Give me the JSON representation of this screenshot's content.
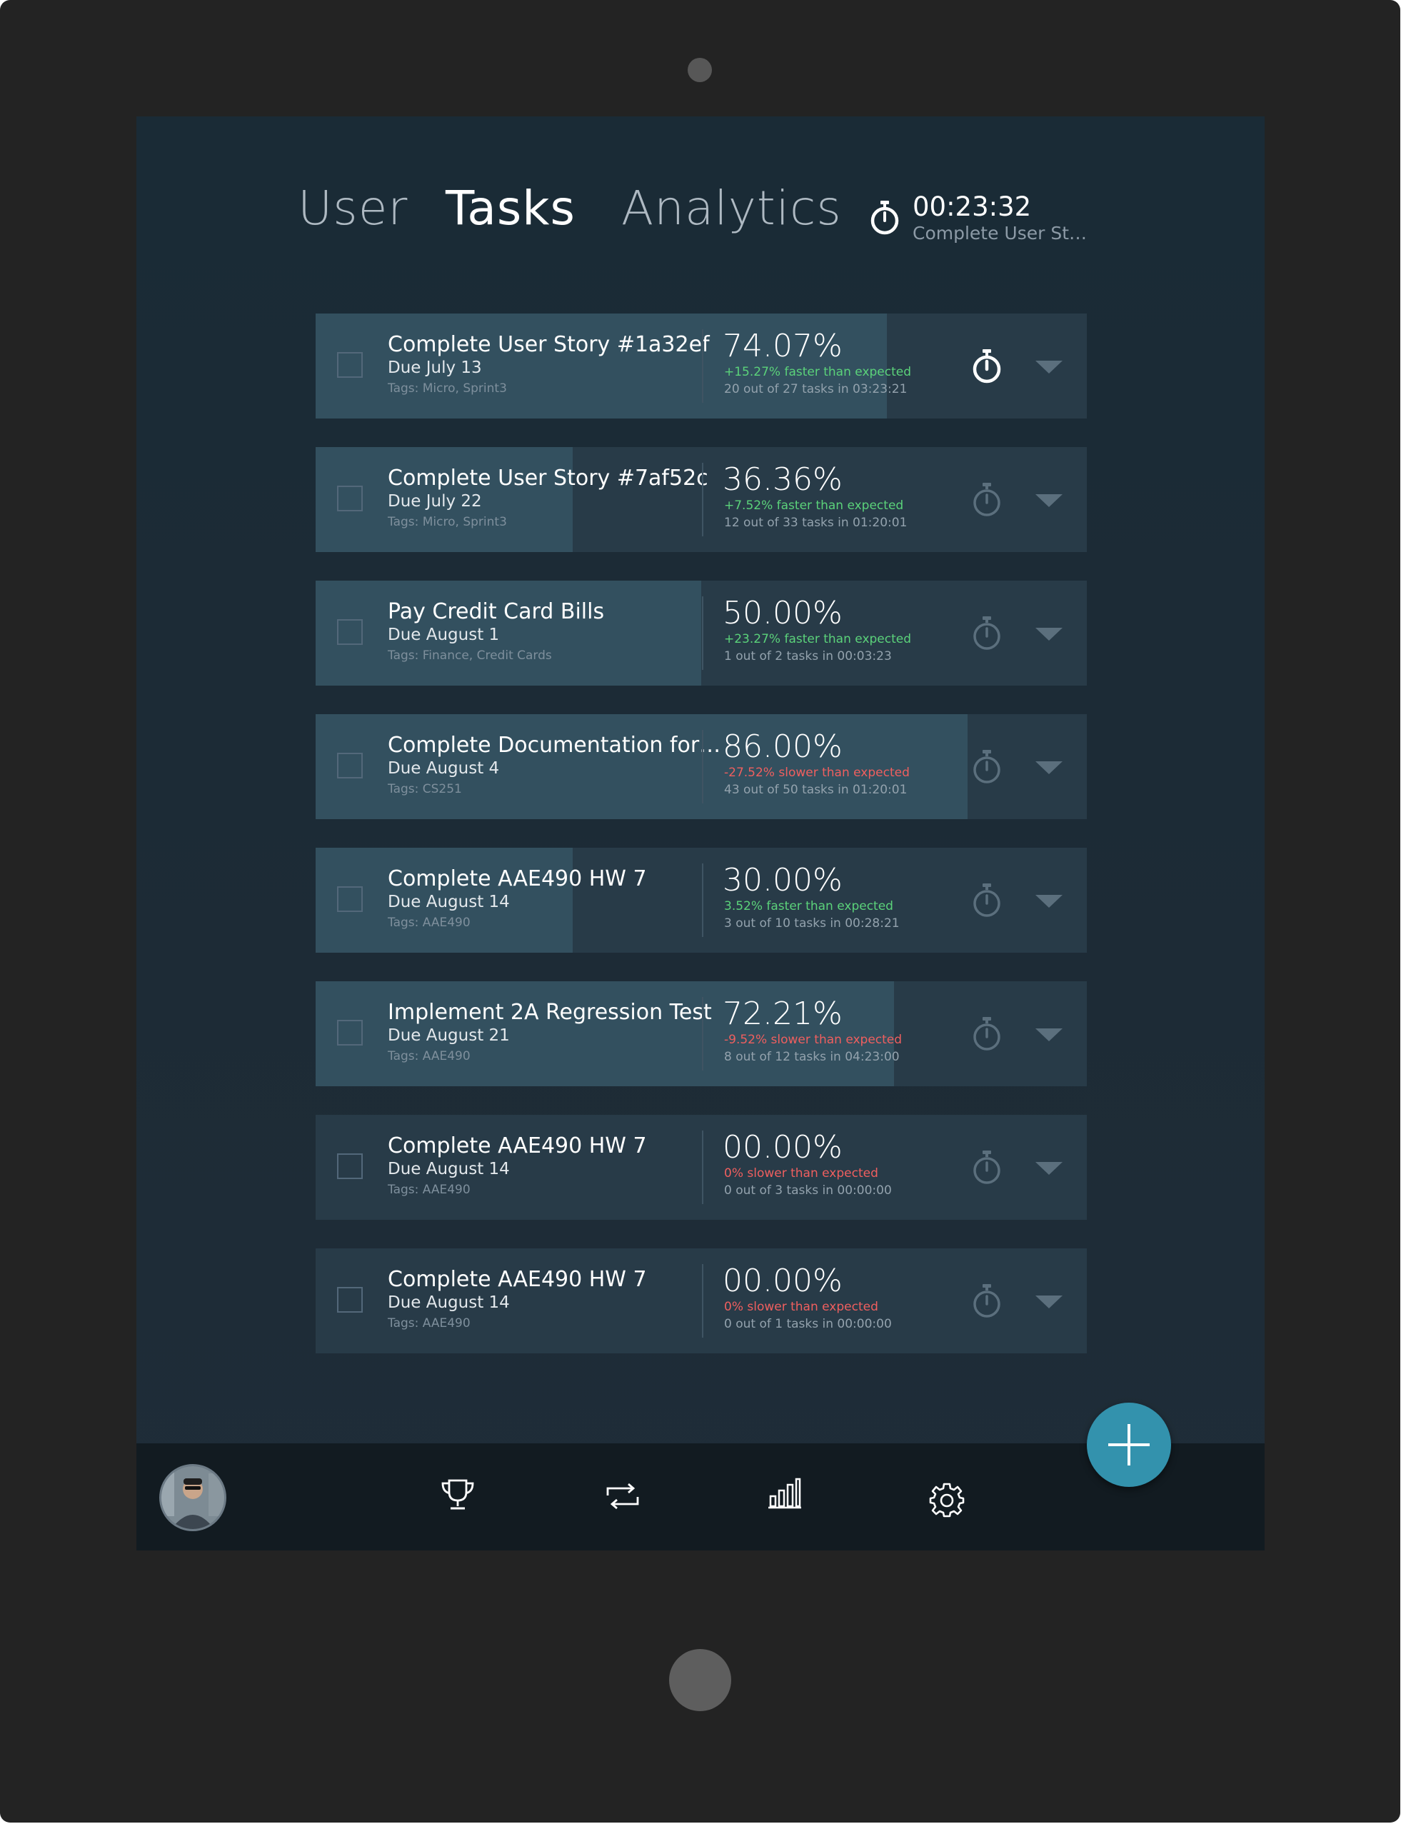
{
  "nav": {
    "tabs": [
      {
        "label": "User",
        "active": false
      },
      {
        "label": "Tasks",
        "active": true
      },
      {
        "label": "Analytics",
        "active": false
      }
    ]
  },
  "active_timer": {
    "time": "00:23:32",
    "task": "Complete User St…",
    "icon": "stopwatch-icon"
  },
  "colors": {
    "background": "#1d2b36",
    "row": "#283b48",
    "progress": "#33505f",
    "faster": "#5bd27a",
    "slower": "#ef5f5f",
    "accent": "#3392ad"
  },
  "tasks": [
    {
      "title": "Complete User Story #1a32ef",
      "due": "Due July 13",
      "tags": "Tags: Micro, Sprint3",
      "percent": "74.07%",
      "progress": 74.07,
      "perf": "+15.27% faster than expected",
      "perf_status": "good",
      "stats": "20 out of 27 tasks in 03:23:21",
      "timer_active": true
    },
    {
      "title": "Complete User Story #7af52c",
      "due": "Due July 22",
      "tags": "Tags: Micro, Sprint3",
      "percent": "36.36%",
      "progress": 33.3,
      "perf": "+7.52% faster than expected",
      "perf_status": "good",
      "stats": "12 out of 33 tasks in 01:20:01",
      "timer_active": false
    },
    {
      "title": "Pay Credit Card Bills",
      "due": "Due August 1",
      "tags": "Tags: Finance, Credit Cards",
      "percent": "50.00%",
      "progress": 50.0,
      "perf": "+23.27% faster than expected",
      "perf_status": "good",
      "stats": "1 out of 2 tasks in 00:03:23",
      "timer_active": false
    },
    {
      "title": "Complete Documentation for…",
      "due": "Due August 4",
      "tags": "Tags: CS251",
      "percent": "86.00%",
      "progress": 84.5,
      "perf": "-27.52% slower than expected",
      "perf_status": "bad",
      "stats": "43 out of 50 tasks in 01:20:01",
      "timer_active": false
    },
    {
      "title": "Complete AAE490 HW 7",
      "due": "Due August 14",
      "tags": "Tags: AAE490",
      "percent": "30.00%",
      "progress": 33.3,
      "perf": "3.52% faster than expected",
      "perf_status": "good",
      "stats": "3 out of 10 tasks in 00:28:21",
      "timer_active": false
    },
    {
      "title": "Implement 2A Regression Test",
      "due": "Due August 21",
      "tags": "Tags: AAE490",
      "percent": "72.21%",
      "progress": 75.0,
      "perf": "-9.52% slower than expected",
      "perf_status": "bad",
      "stats": "8 out of 12 tasks in 04:23:00",
      "timer_active": false
    },
    {
      "title": "Complete AAE490 HW 7",
      "due": "Due August 14",
      "tags": "Tags: AAE490",
      "percent": "00.00%",
      "progress": 0,
      "perf": "0% slower than expected",
      "perf_status": "bad",
      "stats": "0 out of 3 tasks in 00:00:00",
      "timer_active": false
    },
    {
      "title": "Complete AAE490 HW 7",
      "due": "Due August 14",
      "tags": "Tags: AAE490",
      "percent": "00.00%",
      "progress": 0,
      "perf": "0% slower than expected",
      "perf_status": "bad",
      "stats": "0 out of 1 tasks in 00:00:00",
      "timer_active": false
    }
  ],
  "bottom_bar": {
    "icons": [
      "avatar",
      "trophy-icon",
      "repeat-icon",
      "bar-chart-icon",
      "gear-icon"
    ],
    "fab_icon": "plus-icon"
  }
}
